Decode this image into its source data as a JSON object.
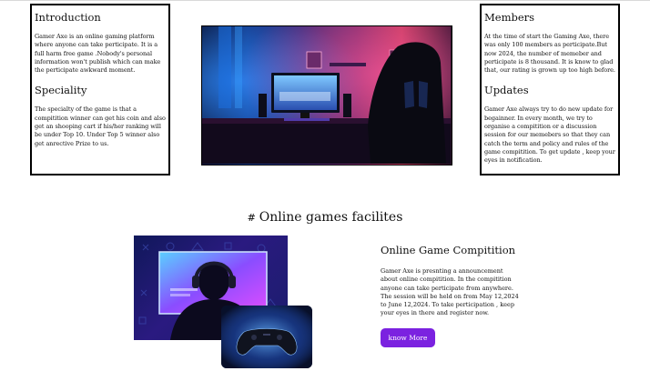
{
  "left_box": {
    "intro_heading": "Introduction",
    "intro_text": "Gamer Axe is an online gaming platform where anyone can take perticipate. It is a full harm free game .Nobody's personal information won't publish which can make the perticipate awkward moment.",
    "speciality_heading": "Speciality",
    "speciality_text": "The specialty of the game is that a compitition winner can get his coin and also get an shooping cart if his/her ranking will be under Top 10. Under Top 5 winner also get anrective Prize to us."
  },
  "right_box": {
    "members_heading": "Members",
    "members_text": "At the time of start the Gaming Axe, there was only 100 members as perticipate.But now 2024, the number of memeber and perticipate is 8 thousand. It is know to glad that, our rating is grown up too high before.",
    "updates_heading": "Updates",
    "updates_text": "Gamer Axe always try to do new update for begainner. In every month, we try to organise a compitition or a discussion session for our memebers so that they can catch the term and policy and rules of the game compitition. To get update , keep your eyes in notification."
  },
  "section": {
    "hash": "#",
    "title": "Online games facilites"
  },
  "card": {
    "title": "Online Game Compitition",
    "text": "Gamer Axe is presnting a announcement about online compitition. In the compitition anyone can take perticipate from anywhere. The session will be held on from May 12,2024 to June 12,2024. To take perticipation , keep your eyes in there and register now.",
    "button_label": "know More"
  },
  "colors": {
    "button": "#7b22e0",
    "border": "#000000"
  }
}
